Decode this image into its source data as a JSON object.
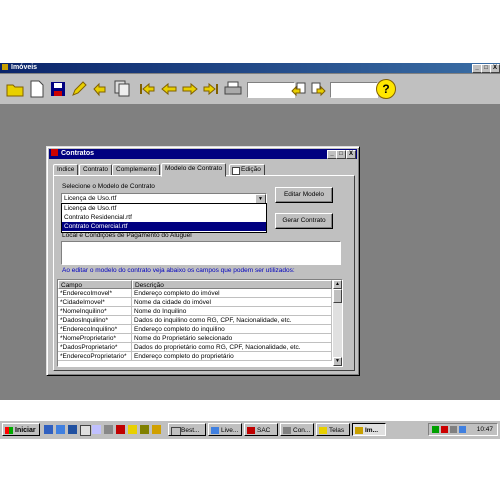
{
  "app": {
    "title": "Imóveis"
  },
  "window_buttons": {
    "minimize": "_",
    "maximize": "□",
    "close": "X"
  },
  "toolbar": {
    "icons": [
      "open-folder-icon",
      "new-document-icon",
      "save-icon",
      "edit-icon",
      "undo-icon",
      "copy-pages-icon",
      "first-record-icon",
      "previous-record-icon",
      "next-record-icon",
      "last-record-icon",
      "print-icon",
      "help-icon"
    ],
    "search1_value": "",
    "search2_value": "",
    "help_label": "?"
  },
  "dialog": {
    "title": "Contratos",
    "tabs": [
      {
        "label": "Indice"
      },
      {
        "label": "Contrato"
      },
      {
        "label": "Complemento"
      },
      {
        "label": "Modelo de Contrato"
      },
      {
        "label": "Edição"
      }
    ],
    "select_label": "Selecione o Modelo de Contrato",
    "combo_value": "Licença de Uso.rtf",
    "dropdown_options": [
      "Licença de Uso.rtf",
      "Contrato Residencial.rtf",
      "Contrato Comercial.rtf"
    ],
    "edit_model_button": "Editar Modelo",
    "generate_button": "Gerar Contrato",
    "location_label": "Local e Condições de Pagamento do Aluguel",
    "location_value": "",
    "info_text": "Ao editar o modelo do contrato veja abaixo os campos que podem ser utilizados:",
    "grid": {
      "headers": [
        "Campo",
        "Descrição"
      ],
      "rows": [
        [
          "*EnderecoImovel*",
          "Endereço completo do imóvel"
        ],
        [
          "*CidadeImovel*",
          "Nome da cidade do imóvel"
        ],
        [
          "*NomeInquilino*",
          "Nome do Inquilino"
        ],
        [
          "*DadosInquilino*",
          "Dados do inquilino como RG, CPF, Nacionalidade, etc."
        ],
        [
          "*EnderecoInquilino*",
          "Endereço completo do inquilino"
        ],
        [
          "*NomeProprietario*",
          "Nome do Proprietário selecionado"
        ],
        [
          "*DadosProprietario*",
          "Dados do proprietário como RG, CPF, Nacionalidade, etc."
        ],
        [
          "*EnderecoProprietario*",
          "Endereço completo do proprietário"
        ]
      ]
    }
  },
  "taskbar": {
    "start_label": "Iniciar",
    "tasks": [
      {
        "label": "Best..."
      },
      {
        "label": "Live..."
      },
      {
        "label": "SAC"
      },
      {
        "label": "Con..."
      },
      {
        "label": "Telas"
      },
      {
        "label": "Im..."
      }
    ],
    "clock": "10:47"
  },
  "colors": {
    "titlebar": "#0a246a",
    "dialog_title": "#000080",
    "selection": "#000080",
    "info_text": "#0000c0",
    "workspace": "#808080"
  }
}
